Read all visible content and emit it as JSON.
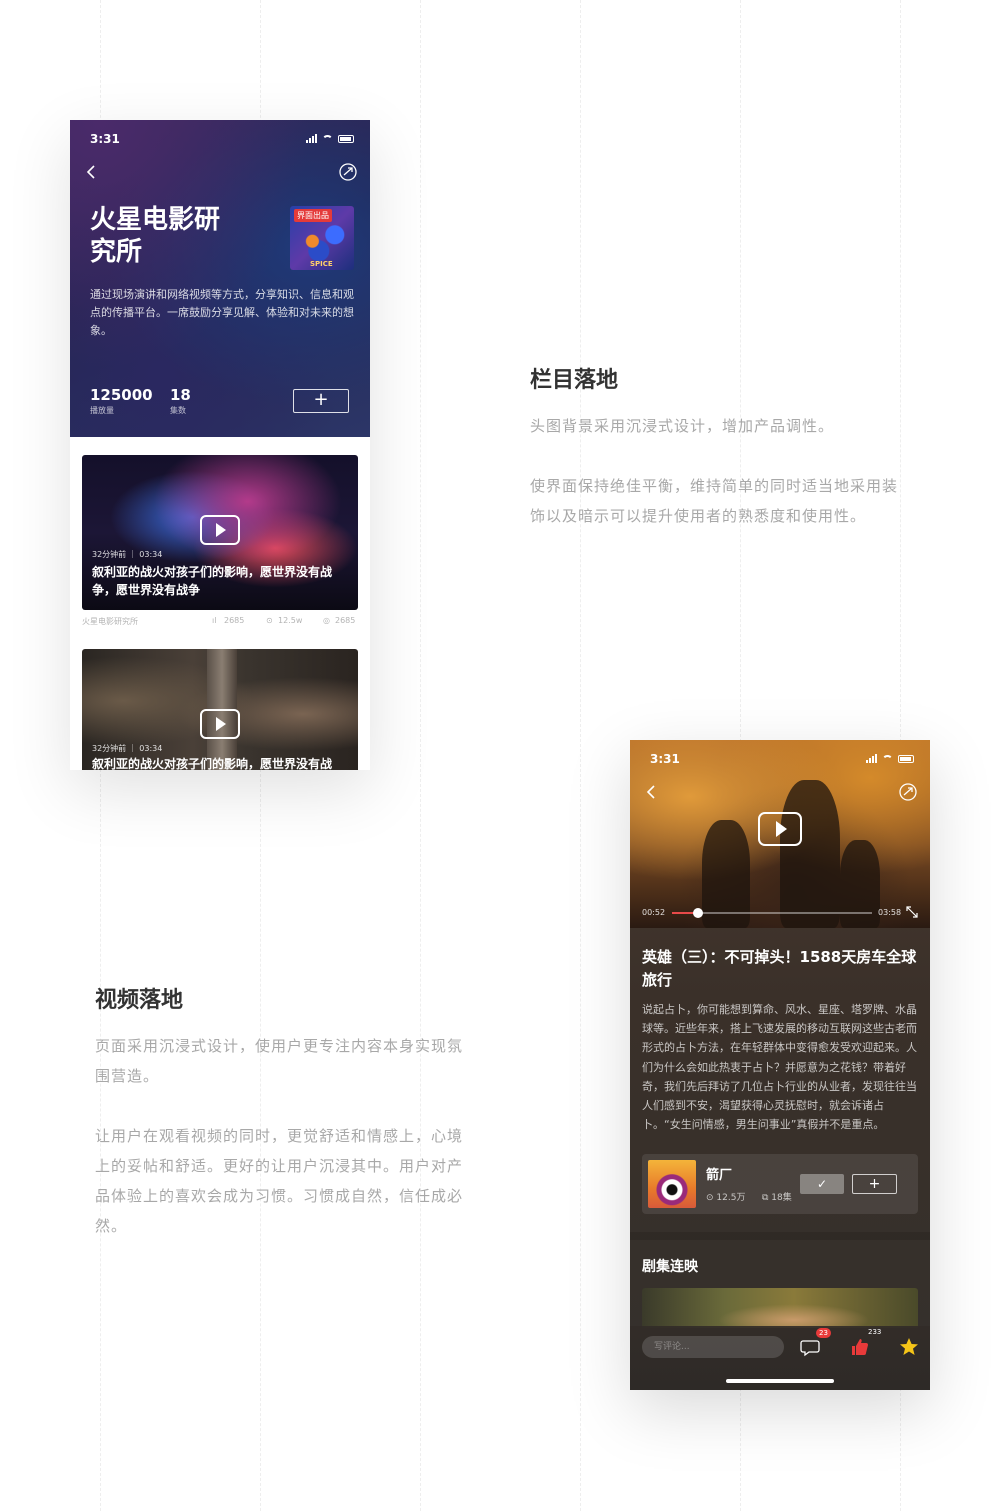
{
  "phone1": {
    "status": {
      "time": "3:31"
    },
    "title": "火星电影研究所",
    "title_line1": "火星电影研",
    "title_line2": "究所",
    "cover": {
      "tag": "界面出品",
      "text": "SPICE"
    },
    "description": "通过现场演讲和网络视频等方式，分享知识、信息和观点的传播平台。一席鼓励分享见解、体验和对未来的想象。",
    "stats": [
      {
        "value": "125000",
        "label": "播放量"
      },
      {
        "value": "18",
        "label": "集数"
      }
    ],
    "add_label": "+",
    "videos": [
      {
        "meta": "32分钟前 ｜ 03:34",
        "title": "叙利亚的战火对孩子们的影响，愿世界没有战争，愿世界没有战争"
      },
      {
        "meta": "32分钟前 ｜ 03:34",
        "title": "叙利亚的战火对孩子们的影响，愿世界没有战"
      }
    ],
    "video_footer": {
      "source": "火星电影研究所",
      "plays": "2685",
      "views": "12.5w",
      "comments": "2685"
    }
  },
  "section1": {
    "title": "栏目落地",
    "para1": "头图背景采用沉浸式设计，增加产品调性。",
    "para2": "使界面保持绝佳平衡，维持简单的同时适当地采用装饰以及暗示可以提升使用者的熟悉度和使用性。"
  },
  "section2": {
    "title": "视频落地",
    "para1": "页面采用沉浸式设计，使用户更专注内容本身实现氛围营造。",
    "para2": "让用户在观看视频的同时，更觉舒适和情感上，心境上的妥帖和舒适。更好的让用户沉浸其中。用户对产品体验上的喜欢会成为习惯。习惯成自然，信任成必然。"
  },
  "phone2": {
    "status": {
      "time": "3:31"
    },
    "player": {
      "current": "00:52",
      "duration": "03:58",
      "progress": 0.13
    },
    "title": "英雄（三）：不可掉头！1588天房车全球旅行",
    "description": "说起占卜，你可能想到算命、风水、星座、塔罗牌、水晶球等。近些年来，搭上飞速发展的移动互联网这些古老而形式的占卜方法，在年轻群体中变得愈发受欢迎起来。人们为什么会如此热衷于占卜？并愿意为之花钱？带着好奇，我们先后拜访了几位占卜行业的从业者，发现往往当人们感到不安，渴望获得心灵抚慰时，就会诉诸占卜。“女生问情感，男生问事业”真假并不是重点。",
    "channel": {
      "name": "箭厂",
      "plays": "12.5万",
      "episodes": "18集",
      "check": "✓",
      "add": "+"
    },
    "series_title": "剧集连映",
    "comment_placeholder": "写评论...",
    "comment_count": "23",
    "like_count": "233"
  },
  "colors": {
    "accent_red": "#e83a3a",
    "star_yellow": "#f5c518"
  }
}
